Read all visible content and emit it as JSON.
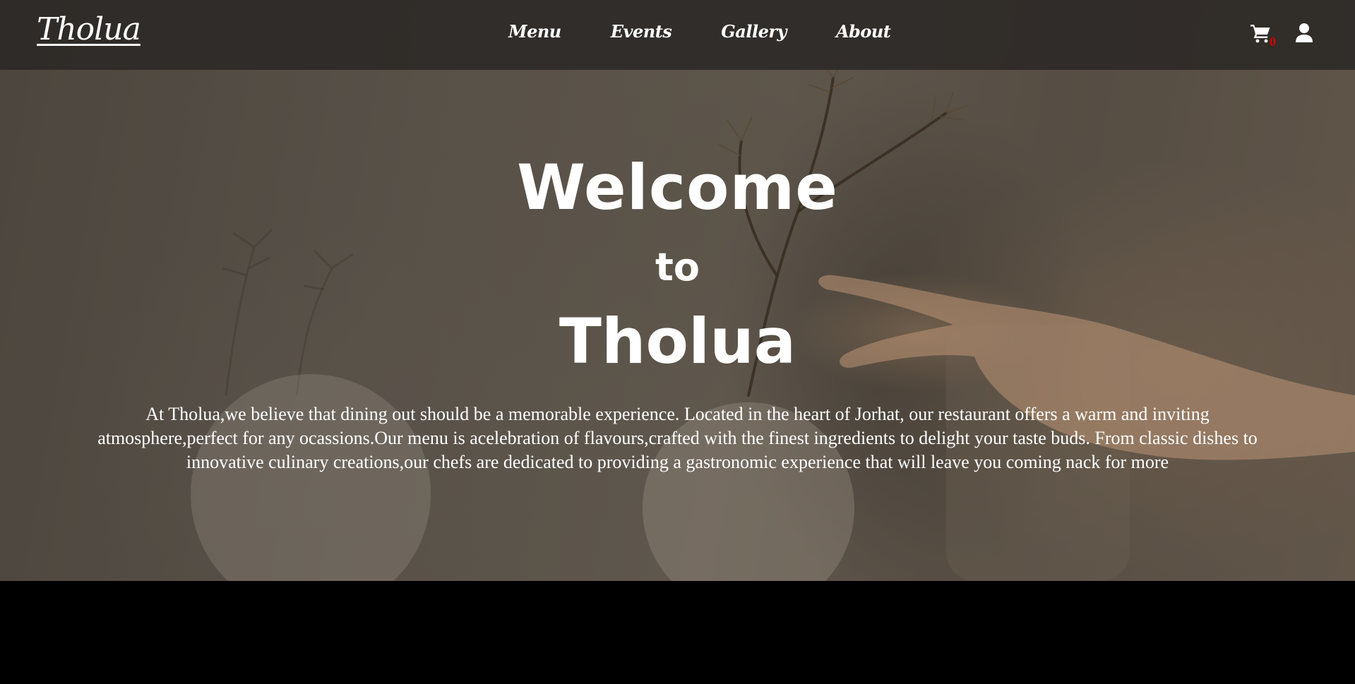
{
  "nav": {
    "brand": "Tholua",
    "links": [
      {
        "label": "Menu"
      },
      {
        "label": "Events"
      },
      {
        "label": "Gallery"
      },
      {
        "label": "About"
      }
    ],
    "cart_count": "0",
    "icons": {
      "cart": "shopping-cart-icon",
      "user": "user-icon"
    }
  },
  "hero": {
    "line1": "Welcome",
    "line2": "to",
    "line3": "Tholua",
    "description": "At Tholua,we believe that dining out should be a memorable experience. Located in the heart of Jorhat, our restaurant offers a warm and inviting atmosphere,perfect for any ocassions.Our menu is acelebration of flavours,crafted with the finest ingredients to delight your taste buds. From classic dishes to innovative culinary creations,our chefs are dedicated to providing a gastronomic experience that will leave you coming nack for more"
  },
  "colors": {
    "nav_bg": "#2b2825",
    "text": "#ffffff",
    "cart_badge": "#d40000",
    "footer_bg": "#000000"
  }
}
